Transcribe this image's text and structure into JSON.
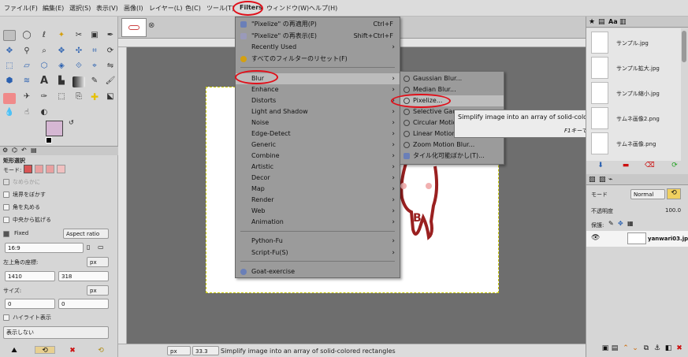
{
  "menubar": {
    "items": [
      "ファイル(F)",
      "編集(E)",
      "選択(S)",
      "表示(V)",
      "画像(I)",
      "レイヤー(L)",
      "色(C)",
      "ツール(T)",
      "Filters",
      "ウィンドウ(W)",
      "ヘルプ(H)"
    ]
  },
  "filters_menu": {
    "repeat_label": "\"Pixelize\" の再適用(P)",
    "repeat_accel": "Ctrl+F",
    "reshow_label": "\"Pixelize\" の再表示(E)",
    "reshow_accel": "Shift+Ctrl+F",
    "recently_used": "Recently Used",
    "reset_all": "すべてのフィルターのリセット(F)",
    "categories": [
      "Blur",
      "Enhance",
      "Distorts",
      "Light and Shadow",
      "Noise",
      "Edge-Detect",
      "Generic",
      "Combine",
      "Artistic",
      "Decor",
      "Map",
      "Render",
      "Web",
      "Animation"
    ],
    "python_fu": "Python-Fu",
    "script_fu": "Script-Fu(S)",
    "goat": "Goat-exercise"
  },
  "blur_submenu": {
    "items": [
      "Gaussian Blur...",
      "Median Blur...",
      "Pixelize...",
      "Selective Gauss",
      "Circular Motion B",
      "Linear Motion B",
      "Zoom Motion Blur...",
      "タイル化可能ぼかし(T)..."
    ]
  },
  "tooltip": {
    "text": "Simplify image into an array of solid-colored rectangles",
    "help": "F1キーでヘルプ表示"
  },
  "tool_options": {
    "title": "矩形選択",
    "mode_label": "モード:",
    "antialias": "なめらかに",
    "feather": "境界をぼかす",
    "rounded": "角を丸める",
    "expand_center": "中央から拡げる",
    "fixed_label": "Fixed",
    "fixed_value": "Aspect ratio",
    "ratio_value": "16:9",
    "position_label": "左上角の座標:",
    "position_unit": "px",
    "position_x": "1410",
    "position_y": "318",
    "size_label": "サイズ:",
    "size_unit": "px",
    "size_w": "0",
    "size_h": "0",
    "highlight": "ハイライト表示",
    "guides": "表示しない"
  },
  "statusbar": {
    "unit": "px",
    "zoom": "33.3",
    "message": "Simplify image into an array of solid-colored rectangles"
  },
  "documents": [
    "サンプル.jpg",
    "サンプル拡大.jpg",
    "サンプル縮小.jpg",
    "サムネ画像2.png",
    "サムネ画像.png"
  ],
  "layers": {
    "mode_label": "モード",
    "mode_value": "Normal",
    "opacity_label": "不透明度",
    "opacity_value": "100.0",
    "lock_label": "保護:",
    "layer_name": "yanwari03.jpg"
  },
  "colors": {
    "highlight_circle": "#e0101a",
    "fg_color": "#d5b7d3",
    "bg_color": "#ffffff"
  }
}
